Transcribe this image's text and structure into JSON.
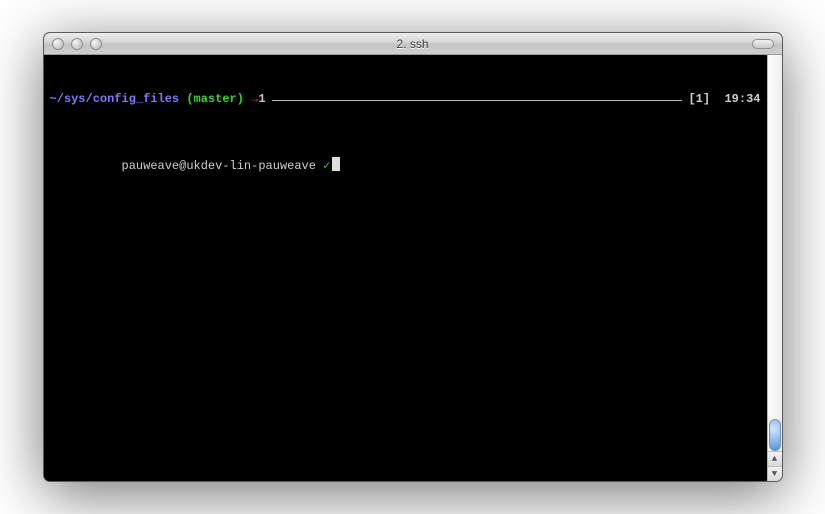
{
  "window": {
    "title": "2. ssh"
  },
  "prompt": {
    "cwd": "~/sys/config_files",
    "branch_open": "(",
    "branch": "master",
    "branch_close": ")",
    "arrow": "→",
    "ahead_count": "1",
    "session": "[1]",
    "time": "19:34",
    "user_host": "pauweave@ukdev-lin-pauweave",
    "check": "✓"
  }
}
